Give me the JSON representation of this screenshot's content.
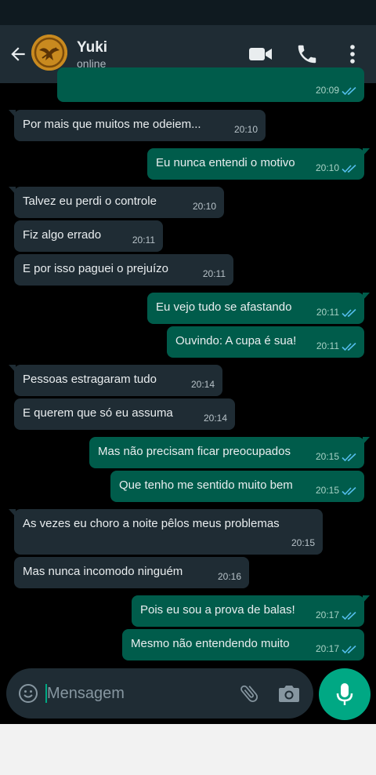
{
  "header": {
    "contact_name": "Yuki",
    "contact_status": "online",
    "icons": [
      "back-arrow-icon",
      "video-call-icon",
      "phone-icon",
      "more-options-icon"
    ]
  },
  "colors": {
    "header_bg": "#1f2c34",
    "incoming_bubble": "#1f2c34",
    "outgoing_bubble": "#005c4b",
    "read_ticks": "#53bdeb",
    "accent": "#00a884",
    "chat_bg": "#000000"
  },
  "messages": [
    {
      "dir": "out",
      "text": "",
      "time": "20:09",
      "read": true
    },
    {
      "dir": "in",
      "text": "Por mais que muitos me odeiem...",
      "time": "20:10"
    },
    {
      "dir": "out",
      "text": "Eu nunca entendi o motivo",
      "time": "20:10",
      "read": true
    },
    {
      "dir": "in",
      "text": "Talvez eu perdi o controle",
      "time": "20:10"
    },
    {
      "dir": "in",
      "text": "Fiz algo errado",
      "time": "20:11"
    },
    {
      "dir": "in",
      "text": "E por isso paguei o prejuízo",
      "time": "20:11"
    },
    {
      "dir": "out",
      "text": "Eu vejo tudo se afastando",
      "time": "20:11",
      "read": true
    },
    {
      "dir": "out",
      "text": "Ouvindo: A cupa é sua!",
      "time": "20:11",
      "read": true
    },
    {
      "dir": "in",
      "text": "Pessoas estragaram tudo",
      "time": "20:14"
    },
    {
      "dir": "in",
      "text": "E querem que só eu assuma",
      "time": "20:14"
    },
    {
      "dir": "out",
      "text": "Mas não precisam ficar preocupados",
      "time": "20:15",
      "read": true
    },
    {
      "dir": "out",
      "text": "Que tenho me sentido muito bem",
      "time": "20:15",
      "read": true
    },
    {
      "dir": "in",
      "text": "As vezes eu choro a noite pêlos meus problemas",
      "time": "20:15"
    },
    {
      "dir": "in",
      "text": "Mas nunca incomodo ninguém",
      "time": "20:16"
    },
    {
      "dir": "out",
      "text": "Pois eu sou a prova de balas!",
      "time": "20:17",
      "read": true
    },
    {
      "dir": "out",
      "text": "Mesmo não entendendo muito",
      "time": "20:17",
      "read": true
    }
  ],
  "input": {
    "placeholder": "Mensagem",
    "value": "",
    "icons": [
      "emoji-icon",
      "attach-icon",
      "camera-icon",
      "mic-icon"
    ]
  }
}
